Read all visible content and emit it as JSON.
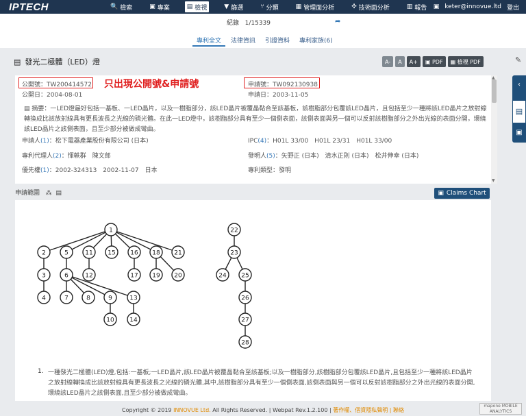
{
  "app": {
    "logo": "IPTECH"
  },
  "nav": [
    {
      "icon": "search-icon",
      "glyph": "🔍",
      "label": "檢索"
    },
    {
      "icon": "briefcase-icon",
      "glyph": "▣",
      "label": "專案"
    },
    {
      "icon": "view-icon",
      "glyph": "▤",
      "label": "檢視",
      "active": true
    },
    {
      "icon": "filter-icon",
      "glyph": "▼",
      "label": "篩選"
    },
    {
      "icon": "branch-icon",
      "glyph": "⑂",
      "label": "分類"
    },
    {
      "icon": "table-icon",
      "glyph": "▦",
      "label": "管理面分析"
    },
    {
      "icon": "chart-icon",
      "glyph": "✣",
      "label": "技術面分析"
    },
    {
      "icon": "report-icon",
      "glyph": "▥",
      "label": "報告"
    }
  ],
  "user": {
    "email": "keter@innovue.ltd",
    "logout": "登出"
  },
  "record": {
    "label": "紀錄",
    "value": "1/15339"
  },
  "tabs": [
    "專利全文",
    "法律資訊",
    "引證資料",
    "專利家族(6)"
  ],
  "patent": {
    "title": "發光二極體（LED）燈",
    "pub_no_label": "公開號：",
    "pub_no": "TW200414572",
    "pub_date_label": "公開日：",
    "pub_date": "2004-08-01",
    "app_no_label": "申請號：",
    "app_no": "TW092130938",
    "app_date_label": "申請日：",
    "app_date": "2003-11-05",
    "annotation": "只出現公開號&申請號",
    "abstract_label": "摘要：",
    "abstract": "一LED燈最好包括一基板、一LED晶片，以及一樹脂部分，該LED晶片被覆晶黏合至該基板，該樹脂部分包覆該LED晶片，且包括至少一種將該LED晶片之放射線轉換成比該放射線具有更長波長之光線的磷光體。在此一LED燈中，該樹脂部分具有至少一個側表面，該側表面與另一個可以反射該樹脂部分之外出光線的表面分開，環繞該LED晶片之該側表面，且至少部分被做成彎曲。",
    "applicant_label": "申請人",
    "applicant_count": "(1)",
    "applicant": "松下電器產業股份有限公司 (日本)",
    "ipc_label": "IPC",
    "ipc_count": "(4)",
    "ipc": "H01L 33/00　H01L 23/31　H01L 33/00",
    "agent_label": "專利代理人",
    "agent_count": "(2)",
    "agent": "惲軼群　陳文郎",
    "inventor_label": "發明人",
    "inventor_count": "(5)",
    "inventor": "矢野正 (日本)　清水正則 (日本)　松井伸幸 (日本)",
    "priority_label": "優先權",
    "priority_count": "(1)",
    "priority": "2002-324313　2002-11-07　日本",
    "type_label": "專利類型",
    "type": "發明"
  },
  "font_buttons": [
    "A-",
    "A",
    "A+",
    "PDF",
    "檢視 PDF"
  ],
  "claims": {
    "label": "申請範圍",
    "chart_button": "Claims Chart",
    "first_num": "1.",
    "first_text": "一種發光二極體(LED)燈,包括:一基板;一LED晶片,該LED晶片被覆晶黏合至該基板;以及一樹脂部分,該樹脂部分包覆該LED晶片,且包括至少一種將該LED晶片之放射線轉換成比該放射線具有更長波長之光線的磷光體,其中,該樹脂部分具有至少一個側表面,該側表面與另一個可以反射該樹脂部分之外出光線的表面分開,環繞該LED晶片之該側表面,且至少部分被做成彎曲。",
    "tree_nodes": [
      "1",
      "2",
      "3",
      "4",
      "5",
      "6",
      "7",
      "8",
      "9",
      "10",
      "11",
      "12",
      "13",
      "14",
      "15",
      "16",
      "17",
      "18",
      "19",
      "20",
      "21",
      "22",
      "23",
      "24",
      "25",
      "26",
      "27",
      "28"
    ]
  },
  "footer": {
    "prefix": "Copyright © 2019 ",
    "company": "INNOVUE Ltd.",
    "middle": " All Rights Reserved. | Webpat Rev.1.2.100 | ",
    "links": "著作權、個資隱私聲明 | 聯絡"
  },
  "badge": "mapone MOBILE ANALYTICS"
}
